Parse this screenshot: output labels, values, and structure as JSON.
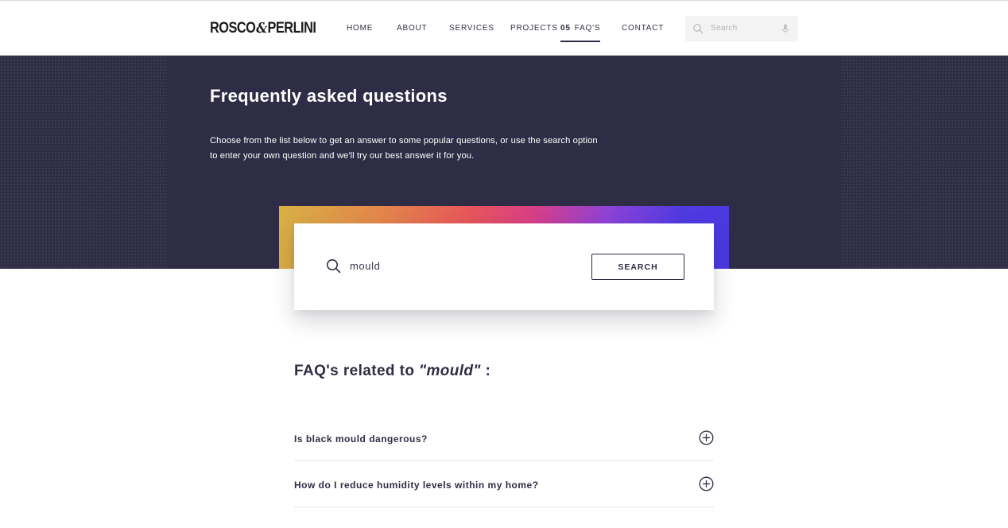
{
  "brand": {
    "logo_left": "ROSCO",
    "logo_amp": "&",
    "logo_right": "PERLINI"
  },
  "nav": {
    "items": [
      {
        "label": "HOME",
        "number": ""
      },
      {
        "label": "ABOUT",
        "number": ""
      },
      {
        "label": "SERVICES",
        "number": ""
      },
      {
        "label": "PROJECTS",
        "number": ""
      },
      {
        "label": "FAQ'S",
        "number": "05",
        "active": true
      },
      {
        "label": "CONTACT",
        "number": ""
      }
    ],
    "search_placeholder": "Search",
    "search_icon": "search-icon",
    "mic_icon": "microphone-icon"
  },
  "hero": {
    "title": "Frequently asked questions",
    "description_line1": "Choose from the list below to get an answer to some popular questions, or use the search option",
    "description_line2": "to enter your own question and we'll try our best answer it for you."
  },
  "search": {
    "query": "mould",
    "button_label": "SEARCH",
    "icon": "search-icon"
  },
  "results": {
    "heading_prefix": "FAQ's related to ",
    "heading_query": "\"mould\"",
    "heading_suffix": " :",
    "items": [
      {
        "question": "Is black mould dangerous?",
        "icon": "plus-circle-icon"
      },
      {
        "question": "How do I reduce humidity levels within my home?",
        "icon": "plus-circle-icon"
      }
    ]
  },
  "colors": {
    "navy": "#2e2d45",
    "gradient": [
      "#d8b045",
      "#e3874b",
      "#e6555a",
      "#d93f84",
      "#8b42d8",
      "#4f3ae0"
    ]
  }
}
